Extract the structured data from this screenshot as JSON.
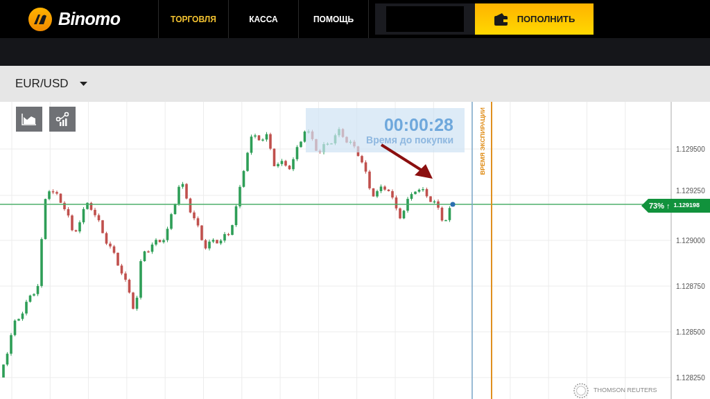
{
  "header": {
    "logo": "Binomo",
    "nav": [
      {
        "label": "ТОРГОВЛЯ",
        "selected": true
      },
      {
        "label": "КАССА",
        "selected": false
      },
      {
        "label": "ПОМОЩЬ",
        "selected": false
      }
    ],
    "deposit_button": "ПОПОЛНИТЬ"
  },
  "asset_selector": {
    "value": "EUR/USD"
  },
  "chart": {
    "timer": {
      "value": "00:00:28",
      "label": "Время до покупки"
    },
    "expiration_label": "ВРЕМЯ ЭКСПИРАЦИИ",
    "price_tag": {
      "payout": "73% ↑",
      "price": "1.129198"
    },
    "price_axis": [
      "1.129500",
      "1.129250",
      "1.129000",
      "1.128750",
      "1.128500",
      "1.128250"
    ],
    "provider": "THOMSON REUTERS"
  }
}
